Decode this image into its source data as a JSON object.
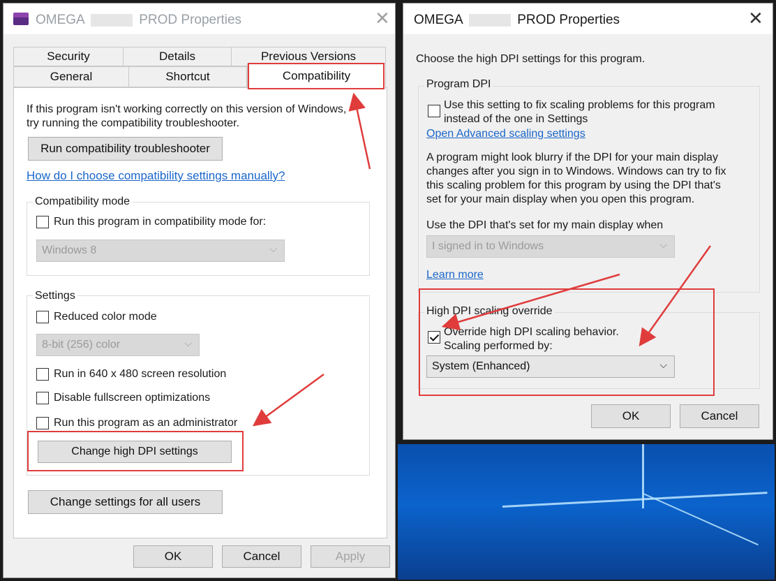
{
  "left_dialog": {
    "title_prefix": "OMEGA",
    "title_suffix": "PROD Properties",
    "tabs": [
      "Security",
      "Details",
      "Previous Versions",
      "General",
      "Shortcut",
      "Compatibility"
    ],
    "intro": "If this program isn't working correctly on this version of Windows,\ntry running the compatibility troubleshooter.",
    "intro_line1": "If this program isn't working correctly on this version of Windows,",
    "intro_line2": "try running the compatibility troubleshooter.",
    "run_troubleshooter": "Run compatibility troubleshooter",
    "manual_link": "How do I choose compatibility settings manually?",
    "compat_mode": {
      "label": "Compatibility mode",
      "checkbox": "Run this program in compatibility mode for:",
      "select_value": "Windows 8"
    },
    "settings": {
      "label": "Settings",
      "reduced_color": "Reduced color mode",
      "color_select": "8-bit (256) color",
      "res_640": "Run in 640 x 480 screen resolution",
      "disable_fullscreen": "Disable fullscreen optimizations",
      "run_admin": "Run this program as an administrator",
      "change_dpi": "Change high DPI settings"
    },
    "all_users": "Change settings for all users",
    "ok": "OK",
    "cancel": "Cancel",
    "apply": "Apply"
  },
  "right_dialog": {
    "title_prefix": "OMEGA",
    "title_suffix": "PROD Properties",
    "heading": "Choose the high DPI settings for this program.",
    "program_dpi": {
      "label": "Program DPI",
      "checkbox_line1": "Use this setting to fix scaling problems for this program",
      "checkbox_line2": "instead of the one in Settings",
      "adv_link": "Open Advanced scaling settings",
      "para_line1": "A program might look blurry if the DPI for your main display",
      "para_line2": "changes after you sign in to Windows. Windows can try to fix",
      "para_line3": "this scaling problem for this program by using the DPI that's",
      "para_line4": "set for your main display when you open this program.",
      "use_dpi_label": "Use the DPI that's set for my main display when",
      "select_value": "I signed in to Windows",
      "learn_more": "Learn more"
    },
    "override": {
      "label": "High DPI scaling override",
      "checkbox_line1": "Override high DPI scaling behavior.",
      "checkbox_line2": "Scaling performed by:",
      "checked": true,
      "select_value": "System (Enhanced)"
    },
    "ok": "OK",
    "cancel": "Cancel"
  },
  "colors": {
    "highlight": "#e03c3c",
    "link": "#1a66c9",
    "desktop": "#0b63cc"
  },
  "icons": [
    "app-icon",
    "close-icon",
    "chevron-down-icon",
    "annotation-arrow"
  ]
}
